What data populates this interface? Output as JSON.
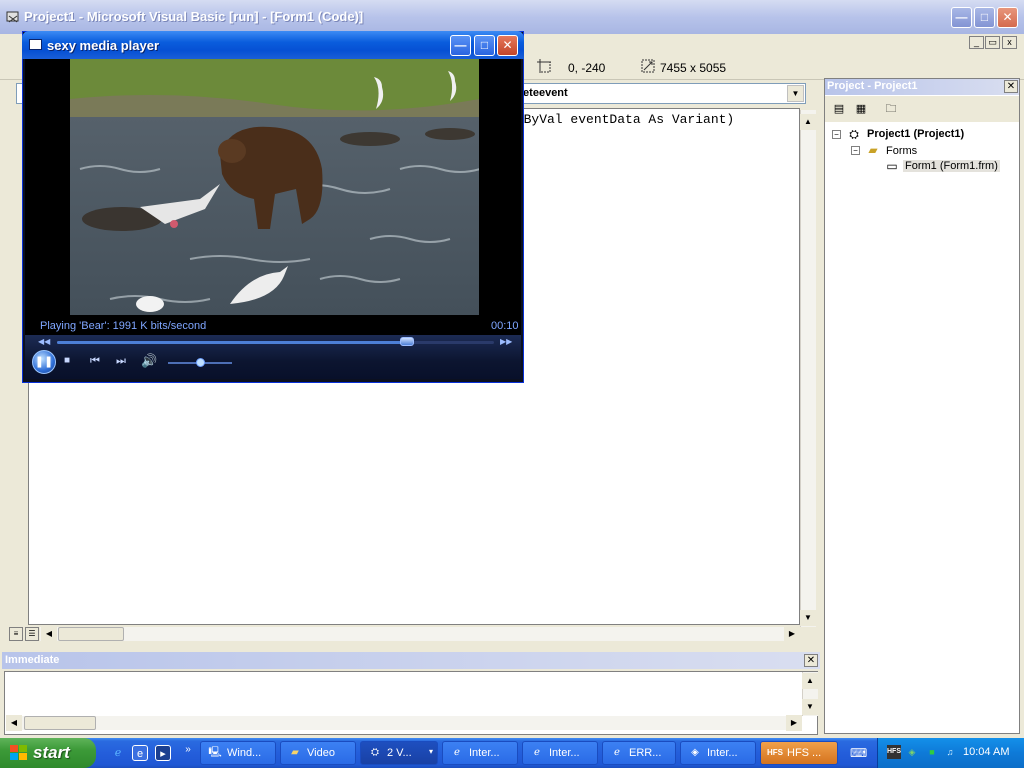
{
  "vb": {
    "title": "Project1 - Microsoft Visual Basic [run] - [Form1 (Code)]",
    "min_label": "—",
    "max_label": "□",
    "close_label": "✕"
  },
  "toolbar": {
    "position": "0, -240",
    "size": "7455 x 5055"
  },
  "code": {
    "procedure_combo": "leteevent",
    "line1": ". ByVal eventData As Variant)"
  },
  "project": {
    "header": "Project - Project1",
    "close_label": "✕",
    "tree": [
      {
        "label": "Project1 (Project1)",
        "toggle": "−"
      },
      {
        "label": "Forms",
        "toggle": "−"
      },
      {
        "label": "Form1 (Form1.frm)",
        "toggle": ""
      }
    ]
  },
  "immediate": {
    "header": "Immediate",
    "close_label": "✕"
  },
  "media_player": {
    "title": "sexy media player",
    "status": "Playing 'Bear': 1991 K bits/second",
    "time": "00:10",
    "seek_progress": 0.8,
    "volume_level": 0.5,
    "min_label": "—",
    "max_label": "□",
    "close_label": "✕"
  },
  "taskbar": {
    "start_label": "start",
    "buttons": [
      {
        "label": "Wind...",
        "icon": "computer-icon"
      },
      {
        "label": "Video",
        "icon": "folder-icon"
      },
      {
        "label": "2 V...",
        "icon": "vb-icon"
      },
      {
        "label": "Inter...",
        "icon": "ie-icon"
      },
      {
        "label": "Inter...",
        "icon": "ie-icon"
      },
      {
        "label": "ERR...",
        "icon": "ie-icon"
      },
      {
        "label": "Inter...",
        "icon": "network-icon"
      },
      {
        "label": "HFS ...",
        "icon": "hfs-icon"
      }
    ],
    "clock": "10:04 AM",
    "hfs_tray": "HFS"
  },
  "colors": {
    "xp_blue": "#245edb",
    "start_green": "#3c9a38",
    "mp_status_text": "#7fa6ff"
  }
}
